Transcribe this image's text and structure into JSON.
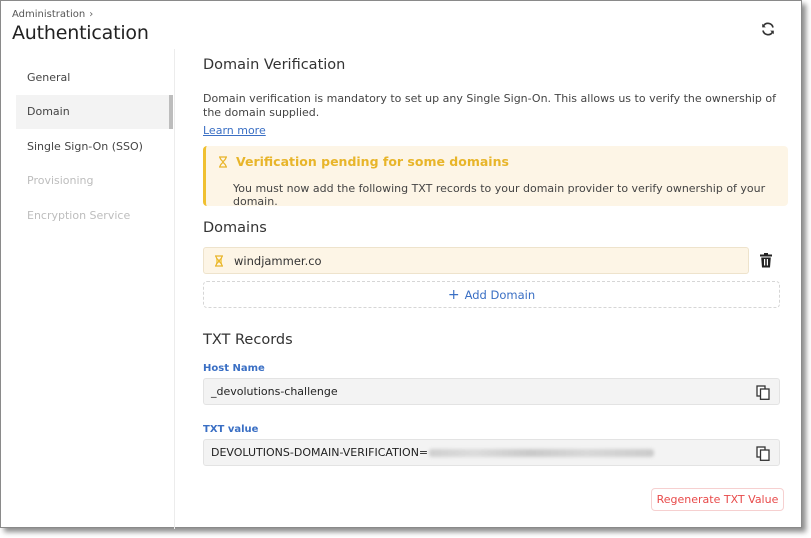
{
  "header": {
    "breadcrumb": "Administration",
    "breadcrumb_separator": "›",
    "title": "Authentication",
    "refresh_icon": "refresh-icon"
  },
  "sidebar": {
    "items": [
      {
        "label": "General",
        "state": "normal"
      },
      {
        "label": "Domain",
        "state": "active"
      },
      {
        "label": "Single Sign-On (SSO)",
        "state": "normal"
      },
      {
        "label": "Provisioning",
        "state": "disabled"
      },
      {
        "label": "Encryption Service",
        "state": "disabled"
      }
    ]
  },
  "main": {
    "title": "Domain Verification",
    "description": "Domain verification is mandatory to set up any Single Sign-On. This allows us to verify the ownership of the domain supplied.",
    "learn_more": "Learn more",
    "alert": {
      "icon": "hourglass-icon",
      "title": "Verification pending for some domains",
      "text": "You must now add the following TXT records to your domain provider to verify ownership of your domain.",
      "color": "#e8b52a"
    },
    "domains": {
      "title": "Domains",
      "items": [
        {
          "name": "windjammer.co",
          "status": "pending",
          "icon": "hourglass-icon"
        }
      ],
      "delete_icon": "trash-icon",
      "add_label": "Add Domain",
      "add_icon": "+"
    },
    "txt_records": {
      "title": "TXT Records",
      "host_name_label": "Host Name",
      "host_name_value": "_devolutions-challenge",
      "txt_value_label": "TXT value",
      "txt_value_prefix": "DEVOLUTIONS-DOMAIN-VERIFICATION=",
      "txt_value_redacted": true,
      "copy_icon": "copy-icon"
    },
    "regenerate_label": "Regenerate TXT Value"
  },
  "colors": {
    "accent": "#3a6fc4",
    "warning": "#e8b52a",
    "warning_bg": "#fdf5e6",
    "danger": "#e84a4a"
  }
}
